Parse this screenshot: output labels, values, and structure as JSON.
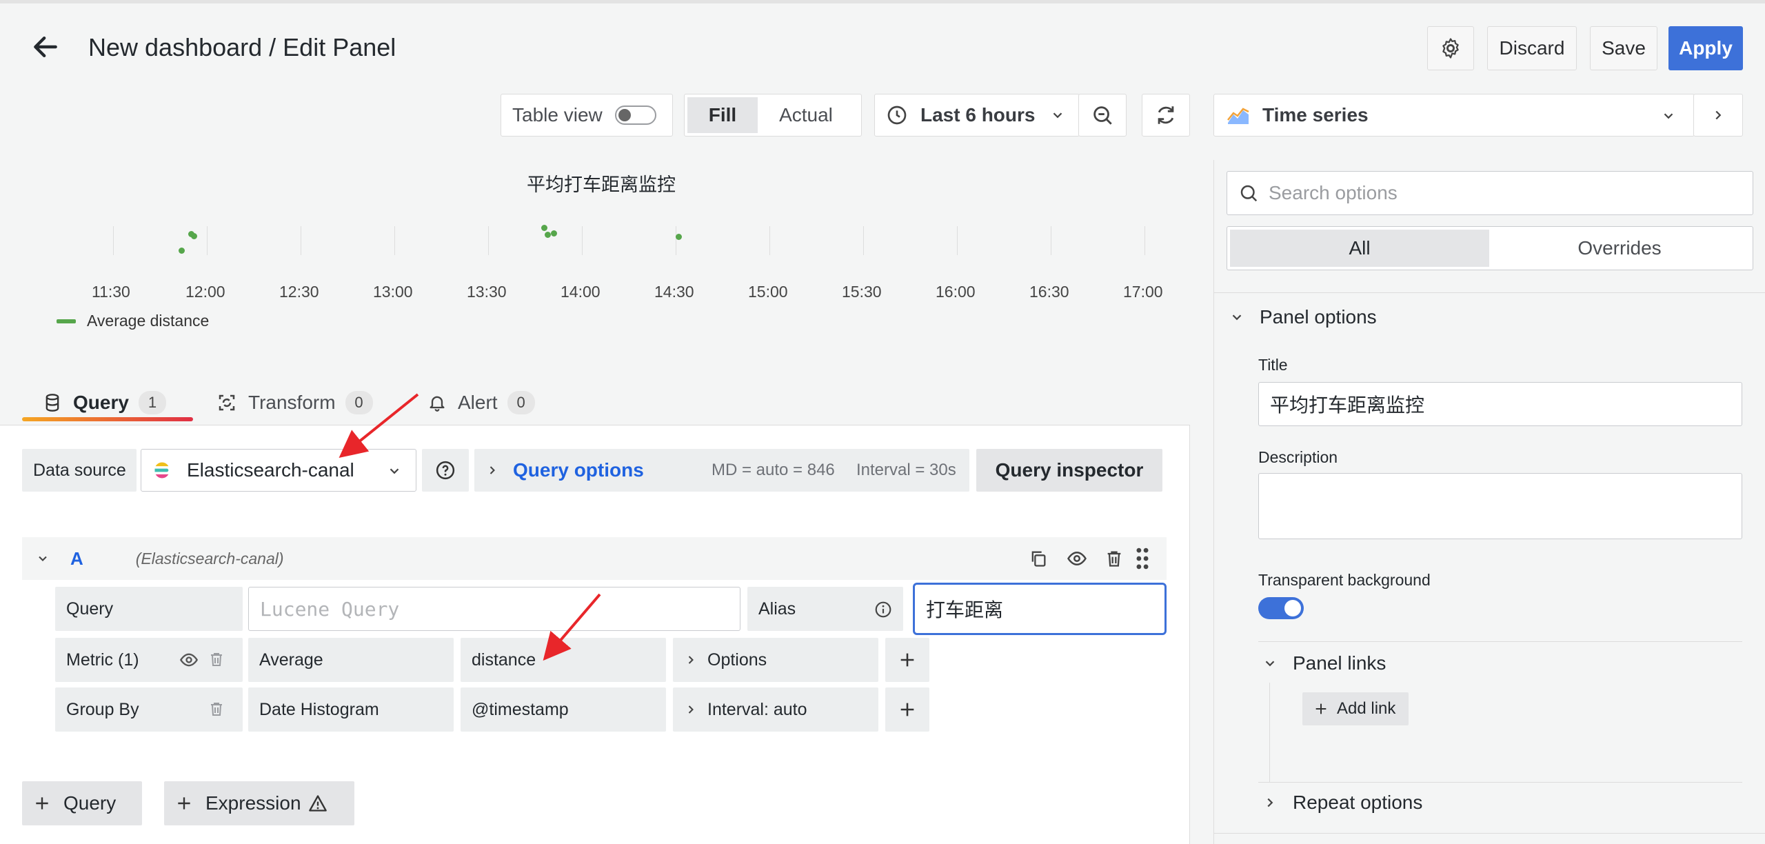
{
  "header": {
    "title": "New dashboard / Edit Panel",
    "discard_label": "Discard",
    "save_label": "Save",
    "apply_label": "Apply"
  },
  "toolbar": {
    "table_view_label": "Table view",
    "fill_label": "Fill",
    "actual_label": "Actual",
    "time_range_label": "Last 6 hours"
  },
  "visualization": {
    "selected": "Time series"
  },
  "chart": {
    "title": "平均打车距离监控",
    "legend": "Average distance",
    "colors": {
      "series": "#56a64b"
    }
  },
  "chart_data": {
    "type": "scatter",
    "title": "平均打车距离监控",
    "xlabel": "",
    "ylabel": "",
    "x_ticks": [
      "11:30",
      "12:00",
      "12:30",
      "13:00",
      "13:30",
      "14:00",
      "14:30",
      "15:00",
      "15:30",
      "16:00",
      "16:30",
      "17:00"
    ],
    "grid": true,
    "legend_placement": "bottom-left",
    "series": [
      {
        "name": "Average distance",
        "points": [
          {
            "x": "11:52",
            "y": 0.15
          },
          {
            "x": "11:55",
            "y": 0.72
          },
          {
            "x": "11:56",
            "y": 0.66
          },
          {
            "x": "13:48",
            "y": 0.95
          },
          {
            "x": "13:49",
            "y": 0.7
          },
          {
            "x": "13:51",
            "y": 0.75
          },
          {
            "x": "14:31",
            "y": 0.62
          }
        ]
      }
    ]
  },
  "tabs": [
    {
      "label": "Query",
      "count": "1"
    },
    {
      "label": "Transform",
      "count": "0"
    },
    {
      "label": "Alert",
      "count": "0"
    }
  ],
  "datasource": {
    "label": "Data source",
    "value": "Elasticsearch-canal",
    "query_options_label": "Query options",
    "md_text": "MD = auto = 846",
    "interval_text": "Interval = 30s",
    "inspector_label": "Query inspector"
  },
  "query_row": {
    "ref": "A",
    "source": "(Elasticsearch-canal)",
    "query_label": "Query",
    "query_placeholder": "Lucene Query",
    "alias_label": "Alias",
    "alias_value": "打车距离",
    "metric_label": "Metric (1)",
    "metric_type": "Average",
    "metric_field": "distance",
    "options_label": "Options",
    "groupby_label": "Group By",
    "groupby_type": "Date Histogram",
    "groupby_field": "@timestamp",
    "interval_label": "Interval: auto"
  },
  "bottom_buttons": {
    "query_label": "Query",
    "expression_label": "Expression"
  },
  "options_pane": {
    "search_placeholder": "Search options",
    "all_label": "All",
    "overrides_label": "Overrides",
    "panel_options_label": "Panel options",
    "title_label": "Title",
    "title_value": "平均打车距离监控",
    "description_label": "Description",
    "transparent_label": "Transparent background",
    "panel_links_label": "Panel links",
    "add_link_label": "Add link",
    "repeat_options_label": "Repeat options"
  }
}
